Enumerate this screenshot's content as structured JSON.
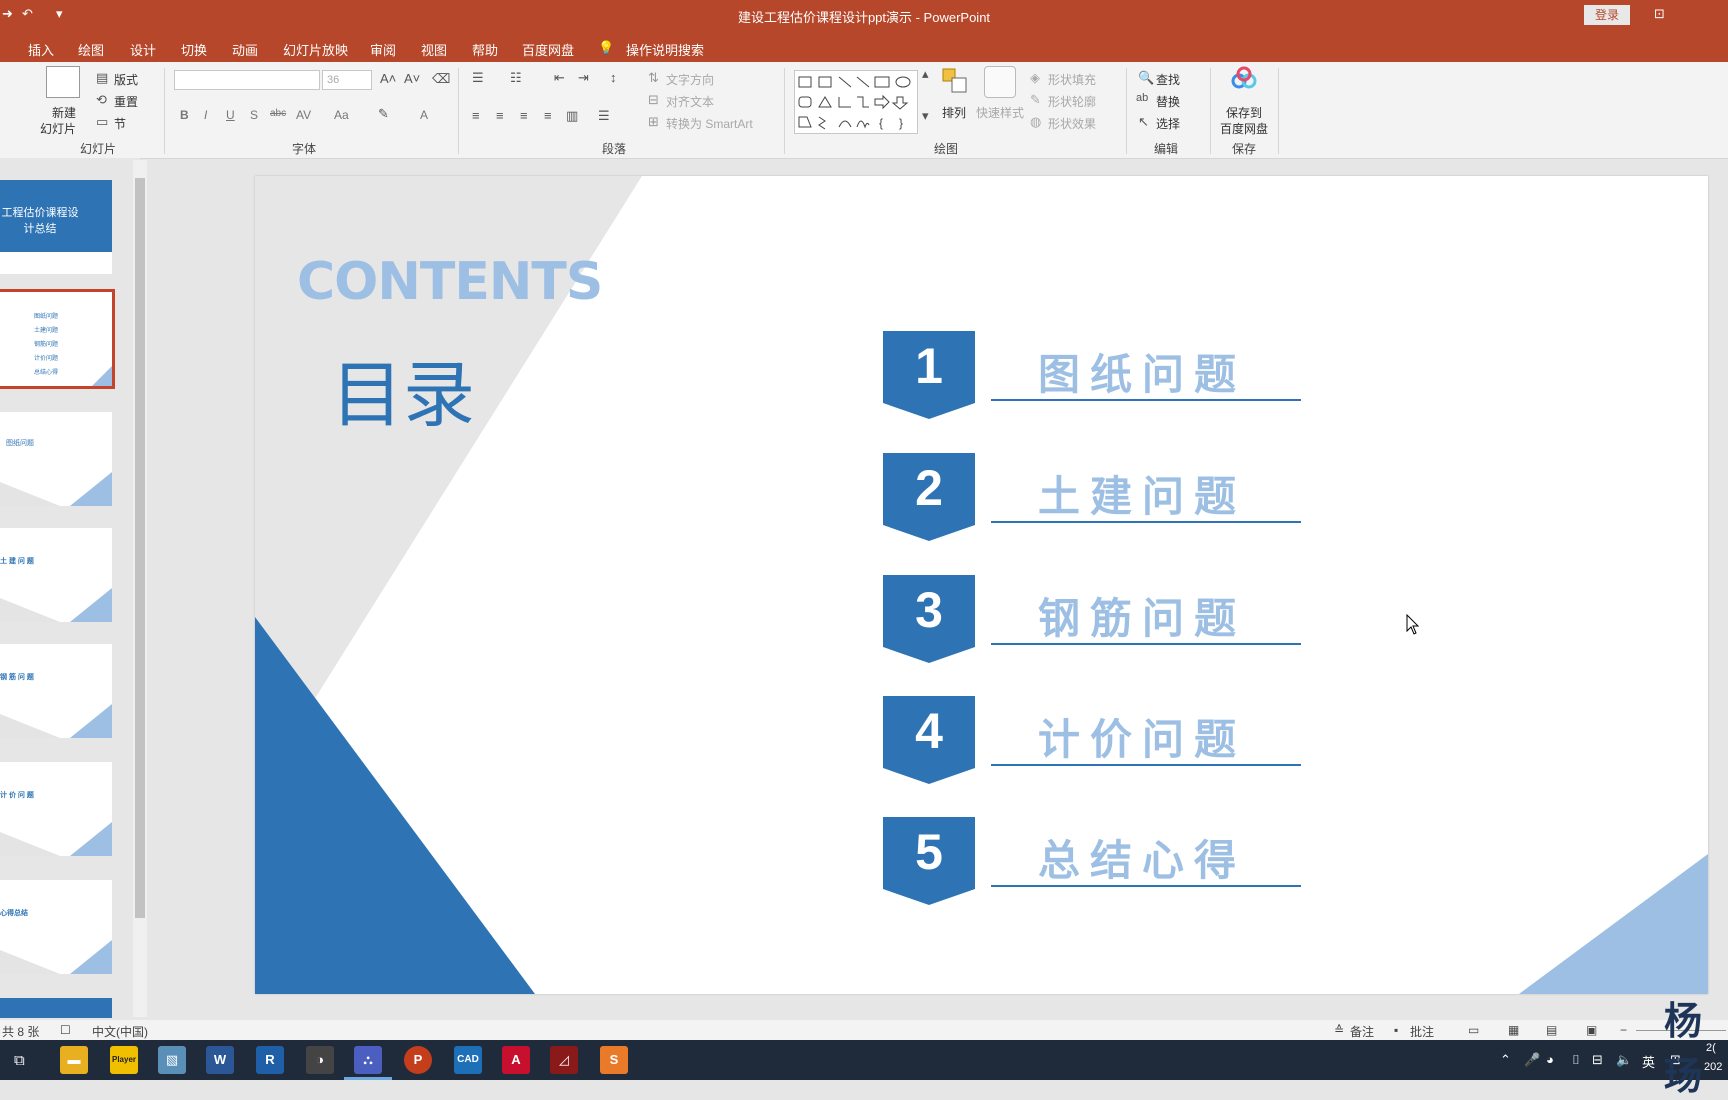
{
  "window": {
    "title": "建设工程估价课程设计ppt演示  -  PowerPoint",
    "login": "登录",
    "quick_access": [
      "save-icon",
      "undo-icon",
      "customize-icon"
    ]
  },
  "menu": {
    "tabs": [
      "插入",
      "绘图",
      "设计",
      "切换",
      "动画",
      "幻灯片放映",
      "审阅",
      "视图",
      "帮助",
      "百度网盘"
    ],
    "search_label": "操作说明搜索"
  },
  "ribbon": {
    "slides": {
      "new_slide_line1": "新建",
      "new_slide_line2": "幻灯片",
      "layout": "版式",
      "reset": "重置",
      "section": "节",
      "group": "幻灯片"
    },
    "font": {
      "font_size": "36",
      "group": "字体",
      "bold": "B",
      "italic": "I",
      "underline": "U",
      "shadow": "S",
      "strike": "abc",
      "spacing": "AV",
      "case": "Aa",
      "color": "A"
    },
    "paragraph": {
      "text_direction": "文字方向",
      "align_text": "对齐文本",
      "smartart": "转换为 SmartArt",
      "group": "段落"
    },
    "drawing": {
      "arrange": "排列",
      "quick_styles": "快速样式",
      "shape_fill": "形状填充",
      "shape_outline": "形状轮廓",
      "shape_effects": "形状效果",
      "group": "绘图"
    },
    "editing": {
      "find": "查找",
      "replace": "替换",
      "select": "选择",
      "group": "编辑"
    },
    "save": {
      "line1": "保存到",
      "line2": "百度网盘",
      "group": "保存"
    }
  },
  "thumbnails": {
    "t1_title": "工程估价课程设计总结",
    "t2_items": [
      "图纸问题",
      "土建问题",
      "钢筋问题",
      "计价问题",
      "总结心得"
    ],
    "t3_title": "图纸问题",
    "t4_title": "土 建 问 题",
    "t5_title": "钢 筋 问 题",
    "t6_title": "计 价 问 题",
    "t7_title": "心得总结"
  },
  "slide": {
    "contents_en": "CONTENTS",
    "contents_cn": "目录",
    "items": [
      {
        "num": "1",
        "label": "图纸问题"
      },
      {
        "num": "2",
        "label": "土建问题"
      },
      {
        "num": "3",
        "label": "钢筋问题"
      },
      {
        "num": "4",
        "label": "计价问题"
      },
      {
        "num": "5",
        "label": "总结心得"
      }
    ]
  },
  "status": {
    "slide_count": "共 8 张",
    "language": "中文(中国)",
    "notes": "备注",
    "comments": "批注"
  },
  "taskbar": {
    "ime": "英",
    "clock_top": "2(",
    "clock_bottom": "202"
  },
  "watermark": "杨 玚",
  "colors": {
    "title_bar": "#b7472a",
    "slide_blue": "#2e74b5",
    "light_blue": "#9cbfe3",
    "selected_thumb": "#c5432a"
  }
}
